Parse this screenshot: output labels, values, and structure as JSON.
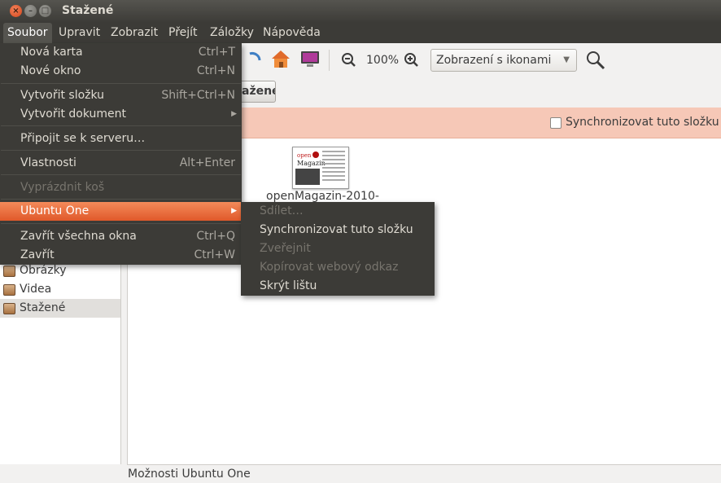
{
  "window": {
    "title": "Stažené"
  },
  "menubar": [
    "Soubor",
    "Upravit",
    "Zobrazit",
    "Přejít",
    "Záložky",
    "Nápověda"
  ],
  "toolbar": {
    "zoom": "100%",
    "view_mode": "Zobrazení s ikonami"
  },
  "location": {
    "current": "ažené"
  },
  "sync_bar": {
    "label": "Synchronizovat tuto složku"
  },
  "file": {
    "name": "openMagazin-2010-"
  },
  "sidebar": {
    "items": [
      "Obrázky",
      "Videa",
      "Stažené"
    ]
  },
  "status": "Možnosti Ubuntu One",
  "file_menu": {
    "new_tab": "Nová karta",
    "new_tab_acc": "Ctrl+T",
    "new_window": "Nové okno",
    "new_window_acc": "Ctrl+N",
    "create_folder": "Vytvořit složku",
    "create_folder_acc": "Shift+Ctrl+N",
    "create_document": "Vytvořit dokument",
    "connect_server": "Připojit se k serveru…",
    "properties": "Vlastnosti",
    "properties_acc": "Alt+Enter",
    "empty_trash": "Vyprázdnit koš",
    "ubuntu_one": "Ubuntu One",
    "close_all": "Zavřít všechna okna",
    "close_all_acc": "Ctrl+Q",
    "close": "Zavřít",
    "close_acc": "Ctrl+W"
  },
  "ubuntu_one_menu": {
    "share": "Sdílet…",
    "sync_folder": "Synchronizovat tuto složku",
    "publish": "Zveřejnit",
    "copy_link": "Kopírovat webový odkaz",
    "hide_bar": "Skrýt lištu"
  },
  "colors": {
    "accent": "#e05a2b",
    "menu_bg": "#3c3b37",
    "sync_bar": "#f6c8b7"
  }
}
